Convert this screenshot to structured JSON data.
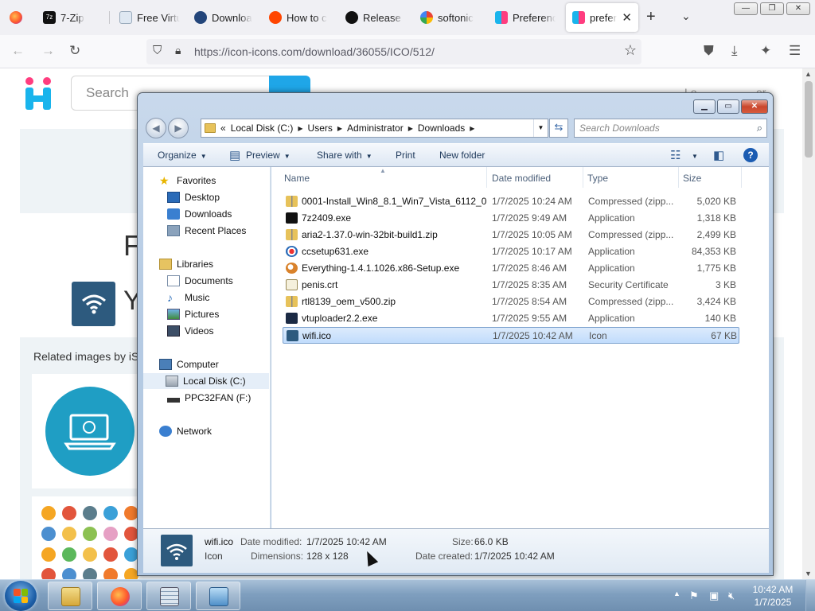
{
  "browser": {
    "tabs": [
      {
        "label": "",
        "icon": "firefox-icon"
      },
      {
        "label": "7-Zip",
        "icon": "7zip-icon"
      },
      {
        "label": "Free Virtu",
        "icon": "page-icon"
      },
      {
        "label": "Downloa",
        "icon": "download-icon"
      },
      {
        "label": "How to c",
        "icon": "reddit-icon"
      },
      {
        "label": "Release a",
        "icon": "github-icon"
      },
      {
        "label": "softonic",
        "icon": "google-icon"
      },
      {
        "label": "Preferenc",
        "icon": "iconicons-icon"
      },
      {
        "label": "prefere",
        "icon": "iconicons-icon",
        "active": true
      }
    ],
    "close_tab": "✕",
    "new_tab": "+",
    "list_tabs": "⌄",
    "url": "https://icon-icons.com/download/36055/ICO/512/",
    "window_min": "—",
    "window_restore": "❐",
    "window_close": "✕"
  },
  "website": {
    "search_placeholder": "Search",
    "related_title": "Related images by iS",
    "heading_letter": "F",
    "heading_letter2": "Y"
  },
  "explorer": {
    "breadcrumb": [
      "Local Disk (C:)",
      "Users",
      "Administrator",
      "Downloads"
    ],
    "breadcrumb_prefix": "«",
    "search_placeholder": "Search Downloads",
    "commands": {
      "organize": "Organize",
      "preview": "Preview",
      "share_with": "Share with",
      "print": "Print",
      "new_folder": "New folder"
    },
    "nav": {
      "favorites": "Favorites",
      "desktop": "Desktop",
      "downloads": "Downloads",
      "recent_places": "Recent Places",
      "libraries": "Libraries",
      "documents": "Documents",
      "music": "Music",
      "pictures": "Pictures",
      "videos": "Videos",
      "computer": "Computer",
      "local_disk": "Local Disk (C:)",
      "ppc32fan": "PPC32FAN (F:)",
      "network": "Network"
    },
    "columns": {
      "name": "Name",
      "date": "Date modified",
      "type": "Type",
      "size": "Size"
    },
    "files": [
      {
        "name": "0001-Install_Win8_8.1_Win7_Vista_6112_0...",
        "date": "1/7/2025 10:24 AM",
        "type": "Compressed (zipp...",
        "size": "5,020 KB",
        "icon": "zip-folder-icon"
      },
      {
        "name": "7z2409.exe",
        "date": "1/7/2025 9:49 AM",
        "type": "Application",
        "size": "1,318 KB",
        "icon": "7zip-icon"
      },
      {
        "name": "aria2-1.37.0-win-32bit-build1.zip",
        "date": "1/7/2025 10:05 AM",
        "type": "Compressed (zipp...",
        "size": "2,499 KB",
        "icon": "zip-folder-icon"
      },
      {
        "name": "ccsetup631.exe",
        "date": "1/7/2025 10:17 AM",
        "type": "Application",
        "size": "84,353 KB",
        "icon": "ccleaner-icon"
      },
      {
        "name": "Everything-1.4.1.1026.x86-Setup.exe",
        "date": "1/7/2025 8:46 AM",
        "type": "Application",
        "size": "1,775 KB",
        "icon": "everything-search-icon"
      },
      {
        "name": "penis.crt",
        "date": "1/7/2025 8:35 AM",
        "type": "Security Certificate",
        "size": "3 KB",
        "icon": "certificate-icon"
      },
      {
        "name": "rtl8139_oem_v500.zip",
        "date": "1/7/2025 8:54 AM",
        "type": "Compressed (zipp...",
        "size": "3,424 KB",
        "icon": "zip-folder-icon"
      },
      {
        "name": "vtuploader2.2.exe",
        "date": "1/7/2025 9:55 AM",
        "type": "Application",
        "size": "140 KB",
        "icon": "virustotal-icon"
      },
      {
        "name": "wifi.ico",
        "date": "1/7/2025 10:42 AM",
        "type": "Icon",
        "size": "67 KB",
        "icon": "wifi-icon",
        "selected": true
      }
    ],
    "details": {
      "filename": "wifi.ico",
      "filetype": "Icon",
      "date_modified_label": "Date modified:",
      "date_modified": "1/7/2025 10:42 AM",
      "dimensions_label": "Dimensions:",
      "dimensions": "128 x 128",
      "size_label": "Size:",
      "size": "66.0 KB",
      "date_created_label": "Date created:",
      "date_created": "1/7/2025 10:42 AM"
    }
  },
  "taskbar": {
    "time": "10:42 AM",
    "date": "1/7/2025"
  },
  "colors": {
    "selection": "#c1dcfc",
    "accent_blue": "#1fa6e8",
    "icon_dark": "#2d5a7e"
  }
}
